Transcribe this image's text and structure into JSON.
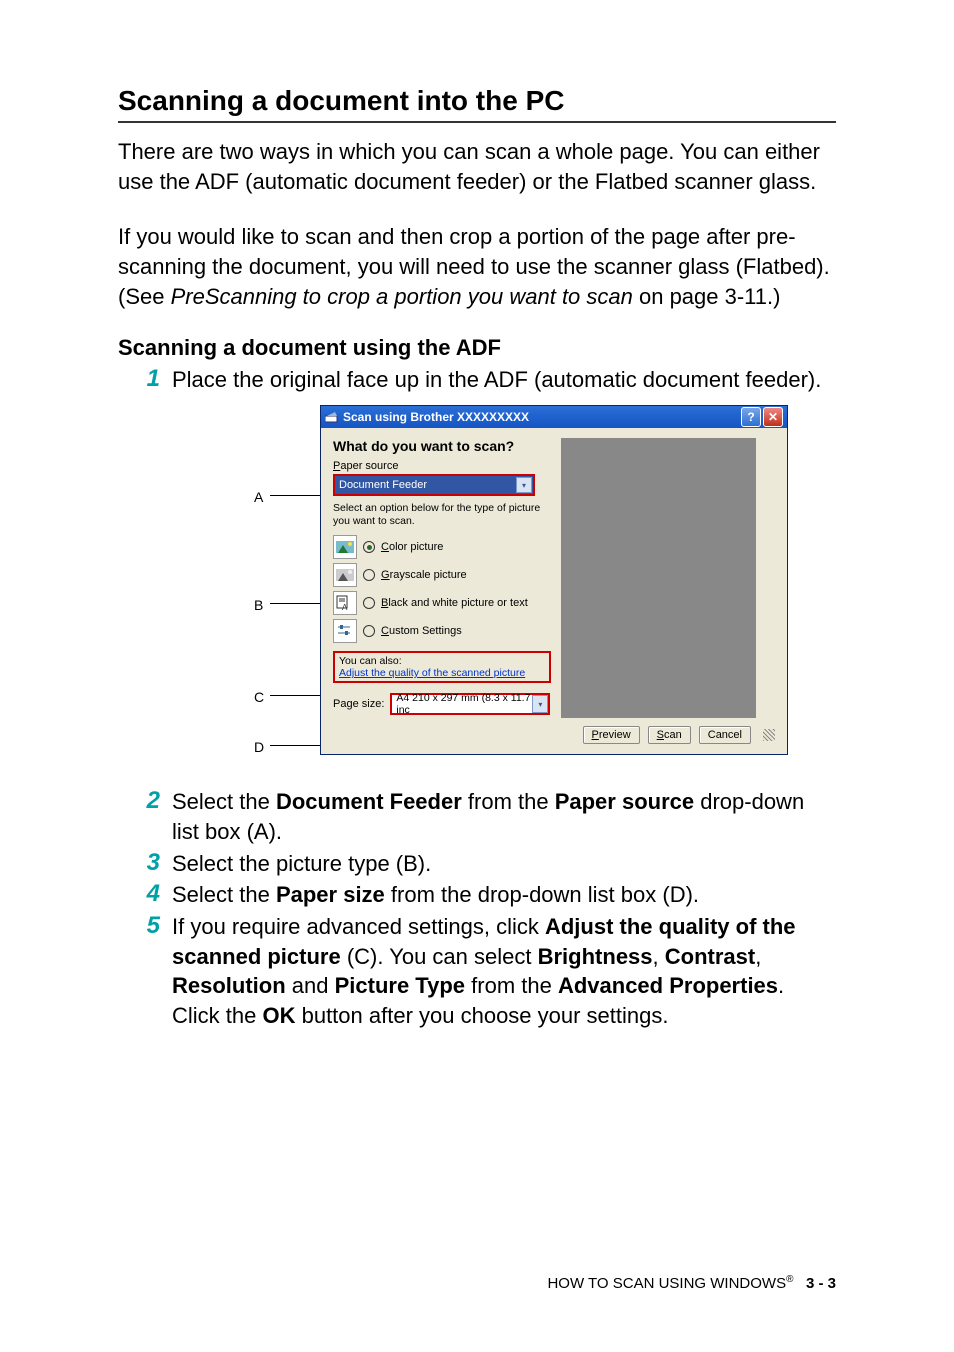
{
  "title": "Scanning a document into the PC",
  "para1": "There are two ways in which you can scan a whole page. You can either use the ADF (automatic document feeder) or the Flatbed scanner glass.",
  "para2a": "If you would like to scan and then crop a portion of the page after pre-scanning the document, you will need to use the scanner glass (Flatbed). (See ",
  "para2_link": "PreScanning to crop a portion you want to scan",
  "para2b": " on page 3-11.)",
  "subtitle": "Scanning a document using the ADF",
  "steps": {
    "s1": "Place the original face up in the ADF (automatic document feeder).",
    "s2_a": "Select the ",
    "s2_b1": "Document Feeder",
    "s2_c": " from the ",
    "s2_b2": "Paper source",
    "s2_d": " drop-down list box (A).",
    "s3": "Select the picture type (B).",
    "s4_a": "Select the ",
    "s4_b": "Paper size",
    "s4_c": " from the drop-down list box (D).",
    "s5_a": "If you require advanced settings, click ",
    "s5_b1": "Adjust the quality of the scanned picture",
    "s5_c": " (C). You can select ",
    "s5_b2": "Brightness",
    "s5_d": ", ",
    "s5_b3": "Contrast",
    "s5_e": ", ",
    "s5_b4": "Resolution",
    "s5_f": " and ",
    "s5_b5": "Picture Type",
    "s5_g": " from the ",
    "s5_b6": "Advanced Properties",
    "s5_h": ". Click the ",
    "s5_b7": "OK",
    "s5_i": " button after you choose your settings."
  },
  "callouts": {
    "A": "A",
    "B": "B",
    "C": "C",
    "D": "D"
  },
  "dialog": {
    "title": "Scan using Brother XXXXXXXXX",
    "heading": "What do you want to scan?",
    "paper_source_label_pre": "P",
    "paper_source_label_post": "aper source",
    "paper_source_value": "Document Feeder",
    "instr": "Select an option below for the type of picture you want to scan.",
    "opt1_pre": "C",
    "opt1_post": "olor picture",
    "opt2_pre": "G",
    "opt2_post": "rayscale picture",
    "opt3_pre": "B",
    "opt3_post": "lack and white picture or text",
    "opt4_pre": "C",
    "opt4_post": "ustom Settings",
    "also_label": "You can also:",
    "also_link": "Adjust the quality of the scanned picture",
    "page_size_label_pre": "Page size",
    "page_size_label_post": ":",
    "page_size_value": "A4 210 x 297 mm (8.3 x 11.7 inc",
    "btn_preview_pre": "P",
    "btn_preview_post": "review",
    "btn_scan_pre": "S",
    "btn_scan_post": "can",
    "btn_cancel": "Cancel"
  },
  "footer": {
    "text": "HOW TO SCAN USING WINDOWS",
    "reg": "®",
    "page": "3 - 3"
  }
}
